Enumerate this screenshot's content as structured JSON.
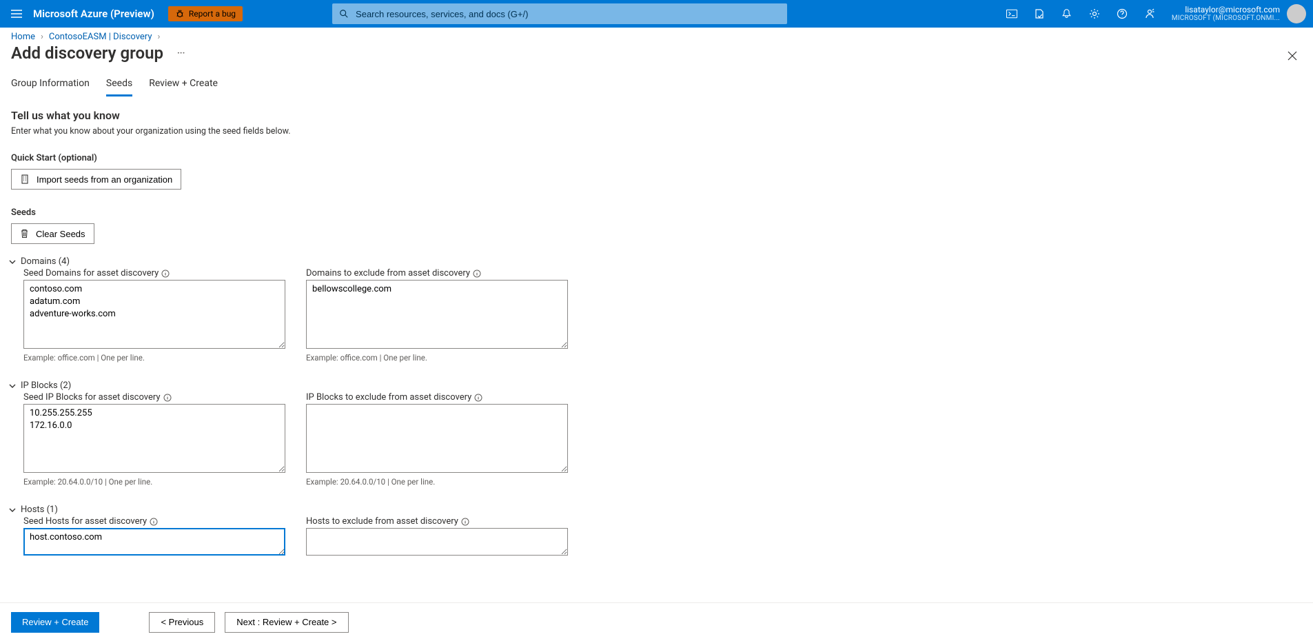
{
  "topbar": {
    "brand": "Microsoft Azure (Preview)",
    "bug_label": "Report a bug",
    "search_placeholder": "Search resources, services, and docs (G+/)",
    "email": "lisataylor@microsoft.com",
    "tenant": "MICROSOFT (MICROSOFT.ONMI..."
  },
  "breadcrumbs": {
    "items": [
      "Home",
      "ContosoEASM | Discovery"
    ]
  },
  "title": "Add discovery group",
  "tabs": [
    "Group Information",
    "Seeds",
    "Review + Create"
  ],
  "active_tab": 1,
  "section": {
    "heading": "Tell us what you know",
    "sub": "Enter what you know about your organization using the seed fields below."
  },
  "quickstart": {
    "label": "Quick Start (optional)",
    "button": "Import seeds from an organization"
  },
  "seeds": {
    "label": "Seeds",
    "clear_button": "Clear Seeds"
  },
  "domains": {
    "header": "Domains (4)",
    "seed_label": "Seed Domains for asset discovery",
    "seed_value": "contoso.com\nadatum.com\nadventure-works.com",
    "exclude_label": "Domains to exclude from asset discovery",
    "exclude_value": "bellowscollege.com",
    "example": "Example: office.com | One per line."
  },
  "ipblocks": {
    "header": "IP Blocks (2)",
    "seed_label": "Seed IP Blocks for asset discovery",
    "seed_value": "10.255.255.255\n172.16.0.0",
    "exclude_label": "IP Blocks to exclude from asset discovery",
    "exclude_value": "",
    "example": "Example: 20.64.0.0/10 | One per line."
  },
  "hosts": {
    "header": "Hosts (1)",
    "seed_label": "Seed Hosts for asset discovery",
    "seed_value": "host.contoso.com\n",
    "exclude_label": "Hosts to exclude from asset discovery",
    "exclude_value": ""
  },
  "footer": {
    "review": "Review + Create",
    "previous": "<  Previous",
    "next": "Next : Review + Create  >"
  }
}
